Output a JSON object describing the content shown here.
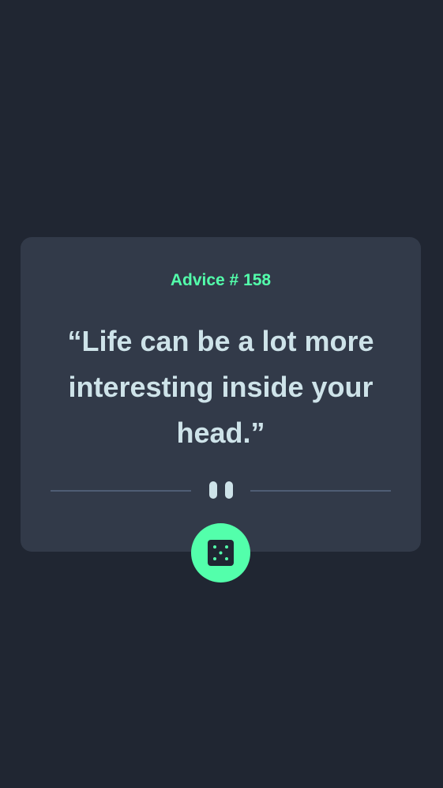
{
  "advice": {
    "heading": "Advice # 158",
    "quote": "“Life can be a lot more interesting inside your head.”"
  },
  "icons": {
    "divider": "pause-icon",
    "button": "dice-icon"
  },
  "colors": {
    "background": "#202632",
    "card": "#323a49",
    "accent": "#53ffab",
    "text": "#cee3e9",
    "divider": "#4f5d74"
  }
}
